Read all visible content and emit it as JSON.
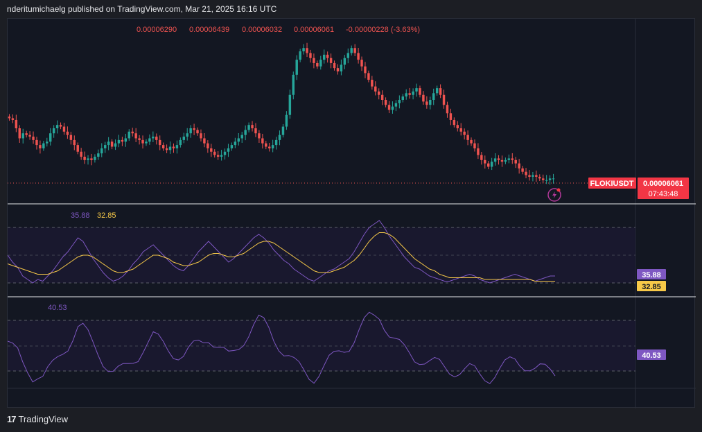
{
  "header": {
    "published": "nderitumichaelg published on TradingView.com, Mar 21, 2025 16:16 UTC"
  },
  "ohlc": {
    "open": "0.00006290",
    "high": "0.00006439",
    "low": "0.00006032",
    "close": "0.00006061",
    "change": "-0.00000228 (-3.63%)"
  },
  "price_tag": {
    "symbol": "FLOKIUSDT",
    "price": "0.00006061",
    "countdown": "07:43:48"
  },
  "rsi": {
    "value": "35.88",
    "ma_value": "32.85",
    "line_color": "#7e57c2",
    "ma_color": "#f7c948"
  },
  "osc": {
    "value": "40.53",
    "line_color": "#7e57c2"
  },
  "footer": {
    "brand": "TradingView"
  },
  "colors": {
    "up": "#26a69a",
    "down": "#ef5350",
    "background": "#131722",
    "label_red": "#f23645",
    "label_purple": "#7e57c2",
    "label_yellow": "#f7c948"
  },
  "chart_data": {
    "type": "candlestick",
    "symbol": "FLOKIUSDT",
    "close_series": [
      110,
      109,
      104,
      98,
      101,
      100,
      99,
      97,
      94,
      92,
      95,
      96,
      101,
      104,
      106,
      105,
      102,
      100,
      97,
      94,
      90,
      87,
      85,
      86,
      85,
      87,
      89,
      92,
      94,
      96,
      93,
      95,
      97,
      96,
      98,
      102,
      101,
      98,
      97,
      95,
      96,
      98,
      99,
      97,
      94,
      92,
      91,
      93,
      92,
      94,
      97,
      99,
      101,
      104,
      103,
      101,
      98,
      95,
      92,
      90,
      88,
      87,
      88,
      90,
      92,
      94,
      96,
      98,
      100,
      103,
      106,
      104,
      101,
      98,
      95,
      93,
      92,
      94,
      97,
      100,
      105,
      112,
      124,
      136,
      145,
      150,
      152,
      149,
      146,
      143,
      141,
      145,
      148,
      146,
      143,
      140,
      138,
      142,
      146,
      149,
      152,
      149,
      145,
      141,
      137,
      133,
      129,
      126,
      124,
      121,
      118,
      115,
      117,
      119,
      121,
      123,
      125,
      124,
      126,
      128,
      124,
      120,
      118,
      121,
      125,
      128,
      124,
      118,
      113,
      109,
      106,
      104,
      102,
      100,
      97,
      95,
      92,
      88,
      85,
      83,
      81,
      84,
      86,
      85,
      84,
      85,
      86,
      85,
      83,
      80,
      78,
      76,
      75,
      76,
      75,
      74,
      73,
      73,
      74,
      74
    ],
    "price_level": "0.00006061",
    "rsi_series": [
      50,
      46,
      43,
      38,
      36,
      34,
      36,
      35,
      38,
      41,
      45,
      49,
      52,
      56,
      60,
      58,
      53,
      48,
      44,
      40,
      37,
      35,
      36,
      38,
      41,
      45,
      48,
      52,
      54,
      56,
      53,
      50,
      47,
      44,
      42,
      41,
      44,
      48,
      52,
      55,
      58,
      55,
      52,
      49,
      46,
      48,
      51,
      54,
      57,
      60,
      62,
      60,
      57,
      53,
      50,
      47,
      45,
      42,
      40,
      38,
      36,
      35,
      37,
      39,
      41,
      42,
      44,
      46,
      48,
      52,
      57,
      62,
      66,
      68,
      70,
      66,
      61,
      57,
      53,
      49,
      46,
      43,
      42,
      40,
      38,
      37,
      36,
      35,
      35,
      36,
      37,
      38,
      39,
      38,
      36,
      35,
      34,
      35,
      36,
      37,
      38,
      39,
      38,
      37,
      36,
      35,
      36,
      37,
      38,
      38
    ],
    "rsi_ma_series": [
      45,
      44,
      43,
      42,
      41,
      40,
      39,
      39,
      39,
      40,
      41,
      43,
      45,
      47,
      49,
      50,
      50,
      49,
      47,
      45,
      43,
      41,
      40,
      40,
      41,
      42,
      44,
      46,
      48,
      50,
      50,
      49,
      48,
      46,
      45,
      44,
      44,
      45,
      46,
      48,
      50,
      51,
      51,
      50,
      49,
      49,
      50,
      51,
      53,
      55,
      57,
      58,
      58,
      57,
      55,
      53,
      51,
      49,
      47,
      45,
      43,
      41,
      40,
      40,
      40,
      41,
      42,
      43,
      45,
      47,
      50,
      54,
      58,
      61,
      63,
      63,
      62,
      60,
      57,
      54,
      51,
      48,
      46,
      44,
      42,
      41,
      39,
      38,
      37,
      37,
      37,
      37,
      37,
      37,
      37,
      36,
      36,
      36,
      36,
      36,
      36,
      36,
      36,
      36,
      36,
      35,
      35,
      35,
      35,
      35
    ]
  }
}
